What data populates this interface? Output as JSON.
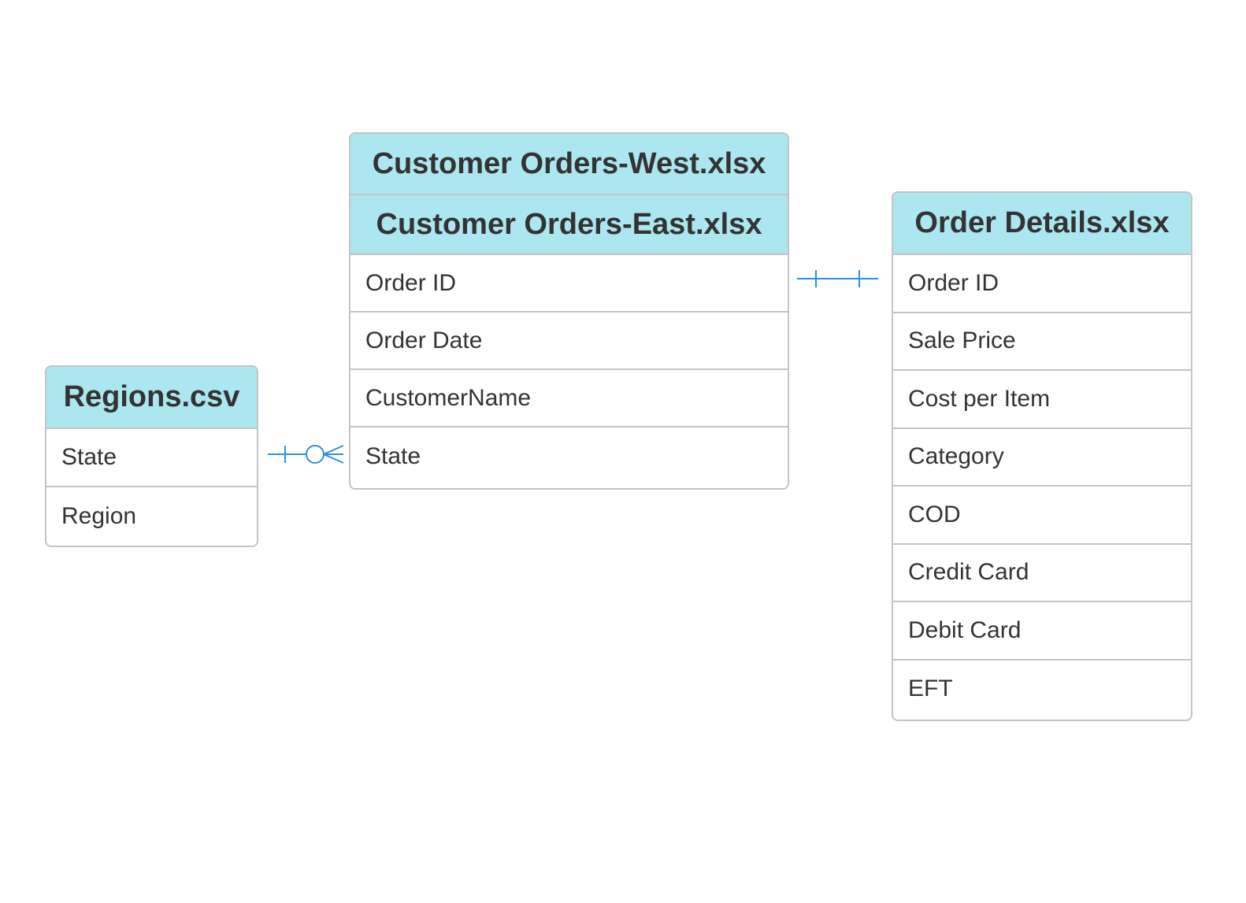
{
  "colors": {
    "header_fill": "#ace6ee",
    "border": "#c4c4c4",
    "connector": "#2f8fdc",
    "text": "#333333"
  },
  "entities": [
    {
      "titles": [
        "Regions.csv"
      ],
      "fields": [
        "State",
        "Region"
      ]
    },
    {
      "titles": [
        "Customer Orders-West.xlsx",
        "Customer Orders-East.xlsx"
      ],
      "fields": [
        "Order ID",
        "Order Date",
        "CustomerName",
        "State"
      ]
    },
    {
      "titles": [
        "Order Details.xlsx"
      ],
      "fields": [
        "Order ID",
        "Sale Price",
        "Cost per Item",
        "Category",
        "COD",
        "Credit Card",
        "Debit Card",
        "EFT"
      ]
    }
  ],
  "relationships": [
    {
      "from": "Regions.csv.State",
      "to": "Customer Orders-East.xlsx.State",
      "from_end": "one",
      "to_end": "zero-or-many"
    },
    {
      "from": "Customer Orders-East.xlsx.Order ID",
      "to": "Order Details.xlsx.Order ID",
      "from_end": "one",
      "to_end": "one"
    }
  ]
}
